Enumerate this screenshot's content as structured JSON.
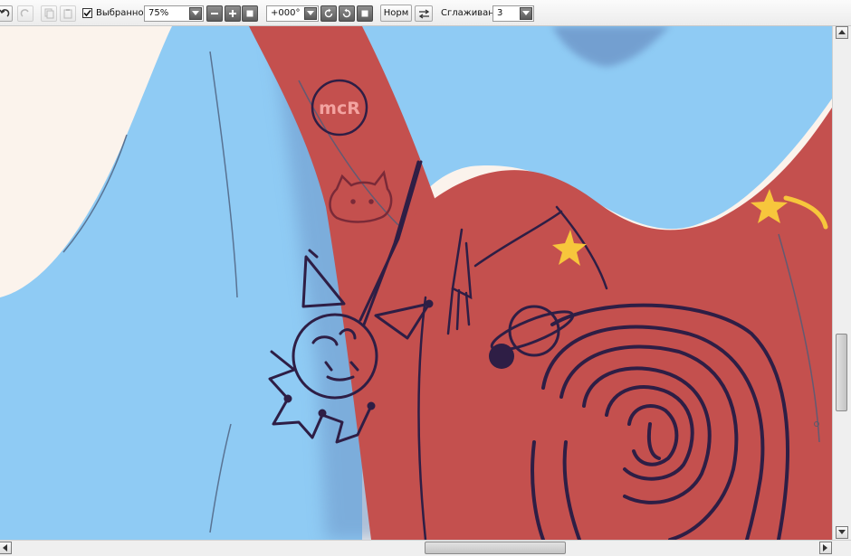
{
  "toolbar": {
    "favorites_checked": true,
    "favorites_label": "Выбранное",
    "zoom_value": "75%",
    "rotation_value": "+000°",
    "normal_label": "Норм",
    "smoothing_label": "Сглаживание",
    "smoothing_value": "3"
  },
  "canvas": {
    "doodle_text": "mcR"
  },
  "scrollbars": {
    "vertical_position": 0.72,
    "horizontal_position": 0.62
  },
  "colors": {
    "sky_blue": "#8fcbf4",
    "shirt_shadow": "#6d95c8",
    "bag_red": "#c4504e",
    "background_cream": "#fbf3ec",
    "line_dark": "#2e1e45",
    "star_yellow": "#f7c63c"
  }
}
